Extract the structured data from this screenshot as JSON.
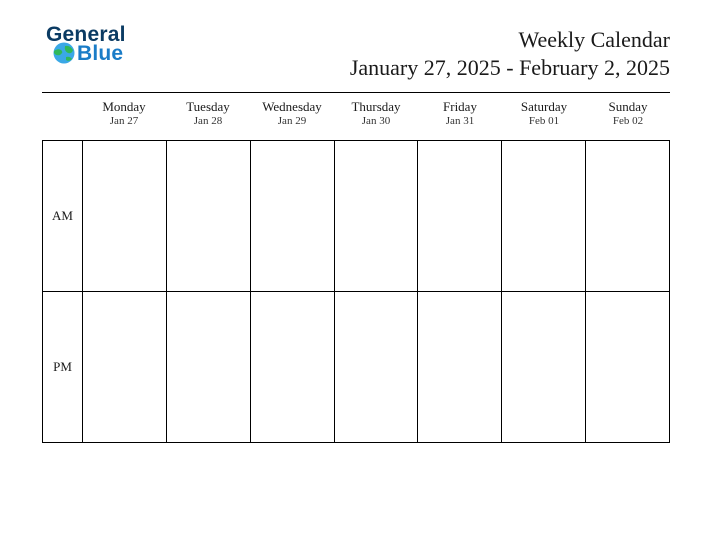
{
  "logo": {
    "word1": "General",
    "word2": "Blue"
  },
  "title": "Weekly Calendar",
  "date_range": "January 27, 2025 - February 2, 2025",
  "time_labels": {
    "am": "AM",
    "pm": "PM"
  },
  "days": [
    {
      "name": "Monday",
      "date": "Jan 27"
    },
    {
      "name": "Tuesday",
      "date": "Jan 28"
    },
    {
      "name": "Wednesday",
      "date": "Jan 29"
    },
    {
      "name": "Thursday",
      "date": "Jan 30"
    },
    {
      "name": "Friday",
      "date": "Jan 31"
    },
    {
      "name": "Saturday",
      "date": "Feb 01"
    },
    {
      "name": "Sunday",
      "date": "Feb 02"
    }
  ]
}
